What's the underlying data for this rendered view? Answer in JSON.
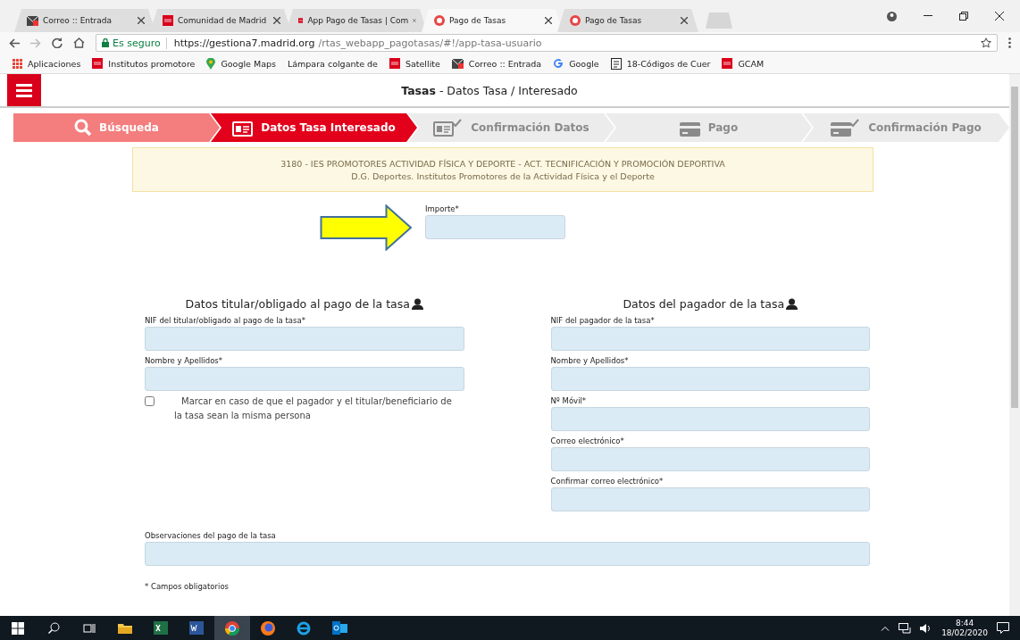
{
  "browser": {
    "tabs": [
      {
        "title": "Correo :: Entrada",
        "kind": "mail",
        "selected": false
      },
      {
        "title": "Comunidad de Madrid",
        "kind": "madrid",
        "selected": false
      },
      {
        "title": "App Pago de Tasas | Com",
        "kind": "madrid",
        "selected": false
      },
      {
        "title": "Pago de Tasas",
        "kind": "app",
        "selected": true
      },
      {
        "title": "Pago de Tasas",
        "kind": "app",
        "selected": false
      }
    ],
    "address": {
      "secure_label": "Es seguro",
      "url_host": "https://gestiona7.madrid.org",
      "url_path": "/rtas_webapp_pagotasas/#!/app-tasa-usuario"
    },
    "bookmarks": [
      {
        "label": "Aplicaciones",
        "kind": "apps"
      },
      {
        "label": "Institutos promotore",
        "kind": "madrid"
      },
      {
        "label": "Google Maps",
        "kind": "maps"
      },
      {
        "label": "Lámpara colgante de",
        "kind": "none"
      },
      {
        "label": "Satellite",
        "kind": "madrid"
      },
      {
        "label": "Correo :: Entrada",
        "kind": "mail"
      },
      {
        "label": "Google",
        "kind": "google"
      },
      {
        "label": "18-Códigos de Cuer",
        "kind": "pdf"
      },
      {
        "label": "GCAM",
        "kind": "madrid"
      }
    ]
  },
  "page": {
    "header": {
      "title": "**Tasas** - Datos Tasa / Interesado"
    },
    "steps": [
      {
        "label": "Búsqueda",
        "kind": "search",
        "confirm": false,
        "completed": true,
        "selected": false
      },
      {
        "label": "Datos Tasa Interesado",
        "kind": "id-card",
        "confirm": false,
        "completed": false,
        "selected": true
      },
      {
        "label": "Confirmación Datos",
        "kind": "id-card",
        "confirm": true,
        "completed": false,
        "selected": false
      },
      {
        "label": "Pago",
        "kind": "card",
        "confirm": false,
        "completed": false,
        "selected": false
      },
      {
        "label": "Confirmación Pago",
        "kind": "card",
        "confirm": true,
        "completed": false,
        "selected": false
      }
    ],
    "notice": [
      "3180  -  IES PROMOTORES ACTIVIDAD FÍSICA Y DEPORTE  -  ACT. TECNIFICACIÓN Y PROMOCIÓN DEPORTIVA",
      "D.G. Deportes. Institutos Promotores de la Actividad Física y el Deporte"
    ],
    "importe": {
      "label": "Importe*"
    },
    "sections": [
      {
        "title": "Datos titular/obligado al pago de la tasa",
        "fields": [
          {
            "label": "NIF del titular/obligado al pago de la tasa*"
          },
          {
            "label": "Nombre y Apellidos*"
          }
        ],
        "checkbox": {
          "label": "Marcar en caso de que el pagador y el titular/beneficiario de la tasa sean la misma persona",
          "checked": false
        }
      },
      {
        "title": "Datos del pagador de la tasa",
        "fields": [
          {
            "label": "NIF del pagador de la tasa*"
          },
          {
            "label": "Nombre y Apellidos*"
          },
          {
            "label": "Nº Móvil*"
          },
          {
            "label": "Correo electrónico*"
          },
          {
            "label": "Confirmar correo electrónico*"
          }
        ]
      }
    ],
    "observaciones": {
      "label": "Observaciones del pago de la tasa"
    },
    "required_note": "* Campos obligatorios"
  },
  "taskbar": {
    "time": "8:44",
    "date": "18/02/2020"
  }
}
